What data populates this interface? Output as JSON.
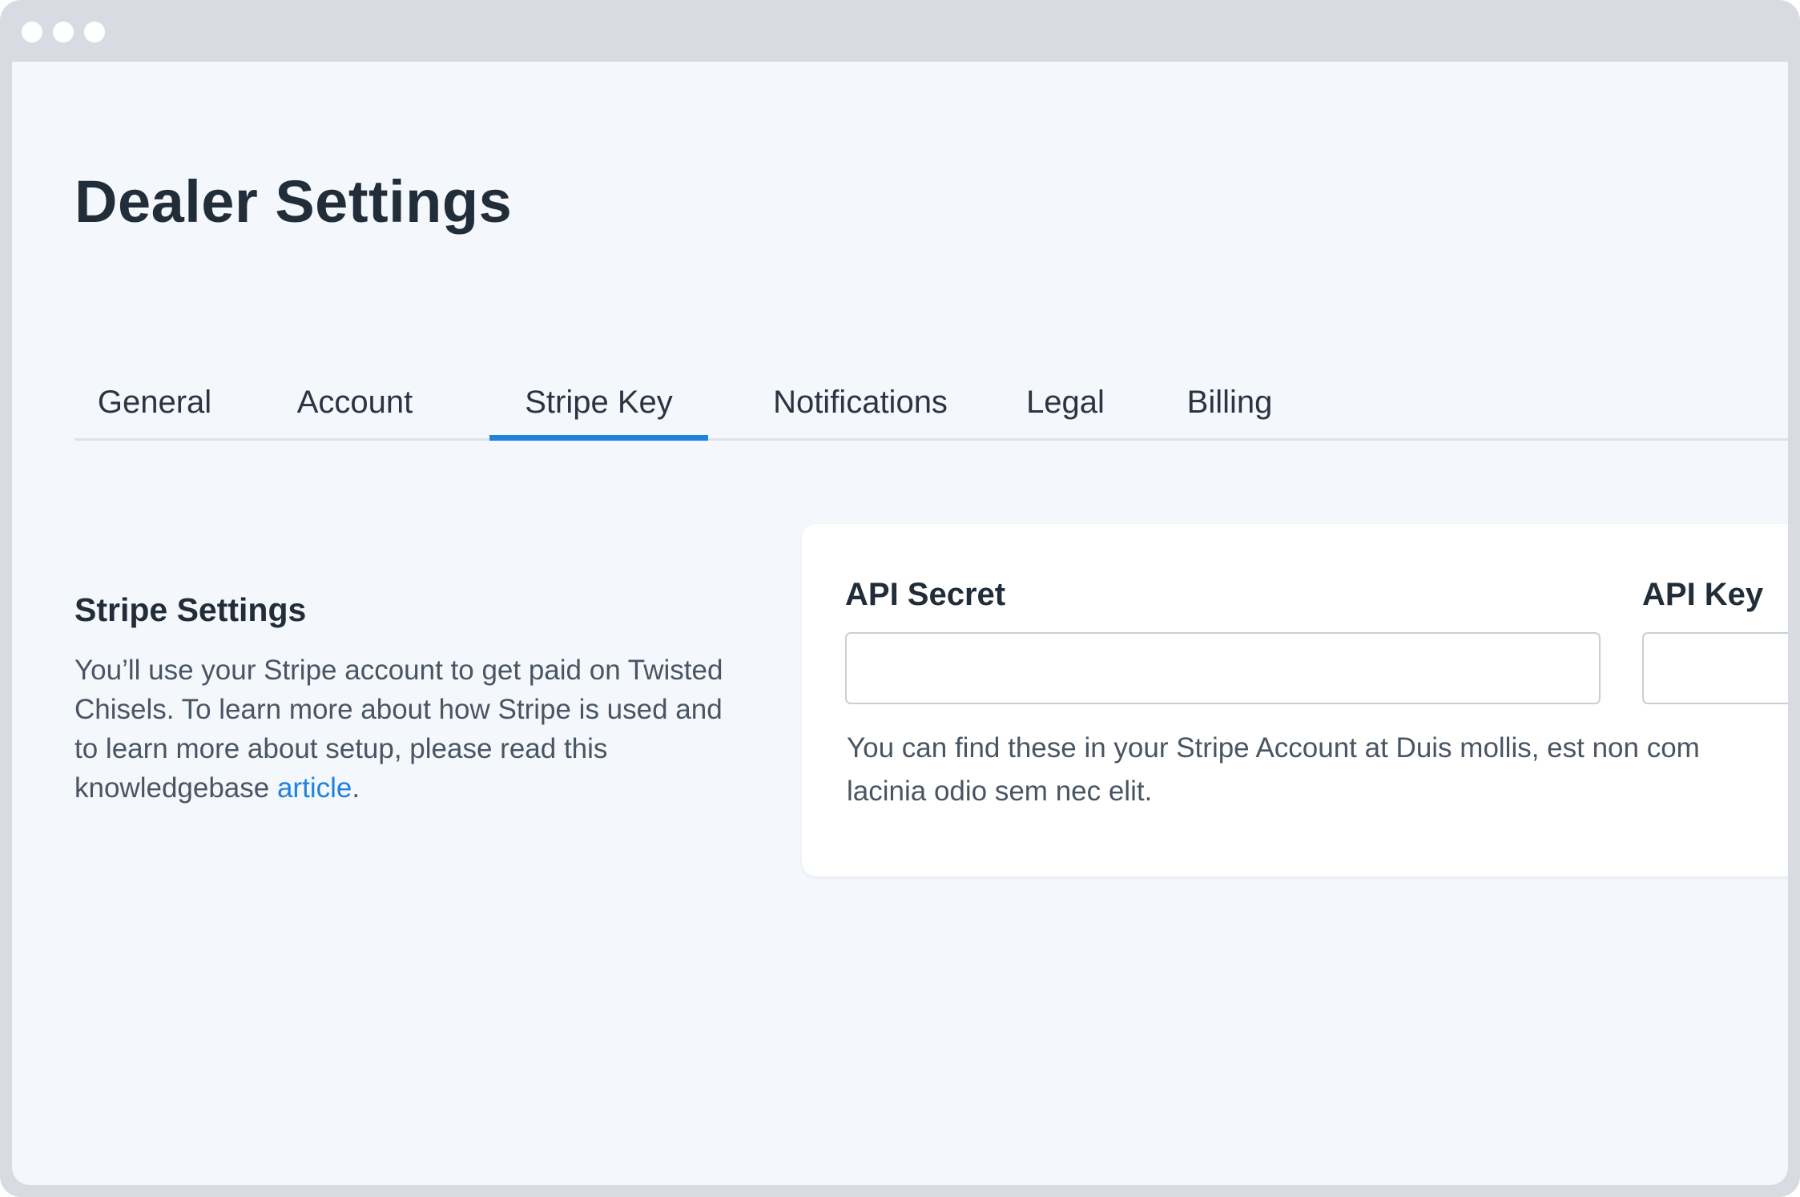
{
  "page": {
    "title": "Dealer Settings"
  },
  "tabs": [
    {
      "label": "General"
    },
    {
      "label": "Account"
    },
    {
      "label": "Stripe Key",
      "active": true
    },
    {
      "label": "Notifications"
    },
    {
      "label": "Legal"
    },
    {
      "label": "Billing"
    }
  ],
  "section": {
    "title": "Stripe Settings",
    "description": "You’ll use your Stripe account to get paid on Twisted Chisels. To learn more about how Stripe is used and to learn more about setup, please read this knowledgebase ",
    "link_text": "article",
    "description_end": "."
  },
  "form": {
    "api_secret_label": "API Secret",
    "api_secret_value": "",
    "api_key_label": "API Key",
    "api_key_value": "",
    "help_line1": "You can find these in your Stripe Account at Duis mollis, est non com",
    "help_line2": "lacinia odio sem nec elit."
  },
  "colors": {
    "accent": "#1f82dd",
    "background": "#f4f7fb",
    "frame": "#d8dce2",
    "heading": "#222d3a"
  }
}
